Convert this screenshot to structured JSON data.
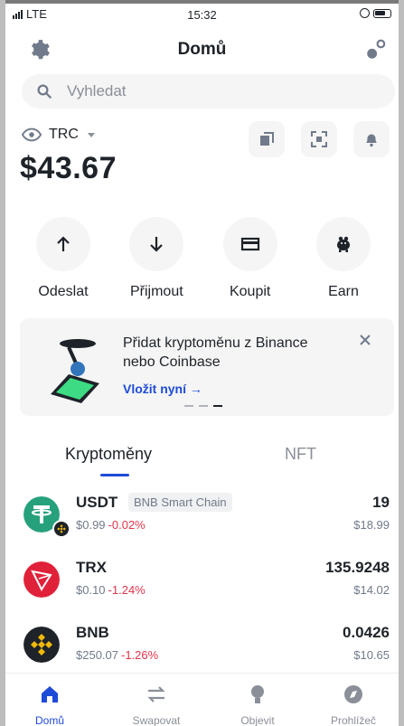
{
  "status_bar": {
    "carrier": "LTE",
    "time": "15:32"
  },
  "header": {
    "title": "Domů",
    "settings_icon": "gear-icon",
    "walletconnect_icon": "link-icon"
  },
  "search": {
    "placeholder": "Vyhledat"
  },
  "wallet": {
    "name": "TRC",
    "balance": "$43.67"
  },
  "actions": [
    {
      "label": "Odeslat",
      "icon": "arrow-up-icon"
    },
    {
      "label": "Přijmout",
      "icon": "arrow-down-icon"
    },
    {
      "label": "Koupit",
      "icon": "card-icon"
    },
    {
      "label": "Earn",
      "icon": "piggy-icon"
    }
  ],
  "promo": {
    "text": "Přidat kryptoměnu z Binance nebo Coinbase",
    "link": "Vložit nyní →"
  },
  "tabs": {
    "crypto": "Kryptoměny",
    "nft": "NFT"
  },
  "tokens": [
    {
      "symbol": "USDT",
      "chain": "BNB Smart Chain",
      "price": "$0.99",
      "change": "-0.02%",
      "amount": "19",
      "value": "$18.99",
      "color": "#26a17b"
    },
    {
      "symbol": "TRX",
      "chain": "",
      "price": "$0.10",
      "change": "-1.24%",
      "amount": "135.9248",
      "value": "$14.02",
      "color": "#e0213a"
    },
    {
      "symbol": "BNB",
      "chain": "",
      "price": "$250.07",
      "change": "-1.26%",
      "amount": "0.0426",
      "value": "$10.65",
      "color": "#1e2329"
    }
  ],
  "nav": [
    {
      "label": "Domů",
      "icon": "home-icon",
      "active": true
    },
    {
      "label": "Swapovat",
      "icon": "swap-icon",
      "active": false
    },
    {
      "label": "Objevit",
      "icon": "discover-icon",
      "active": false
    },
    {
      "label": "Prohlížeč",
      "icon": "compass-icon",
      "active": false
    }
  ],
  "colors": {
    "accent": "#1e4bd8",
    "negative": "#e0344b",
    "surface": "#f5f5f5"
  }
}
